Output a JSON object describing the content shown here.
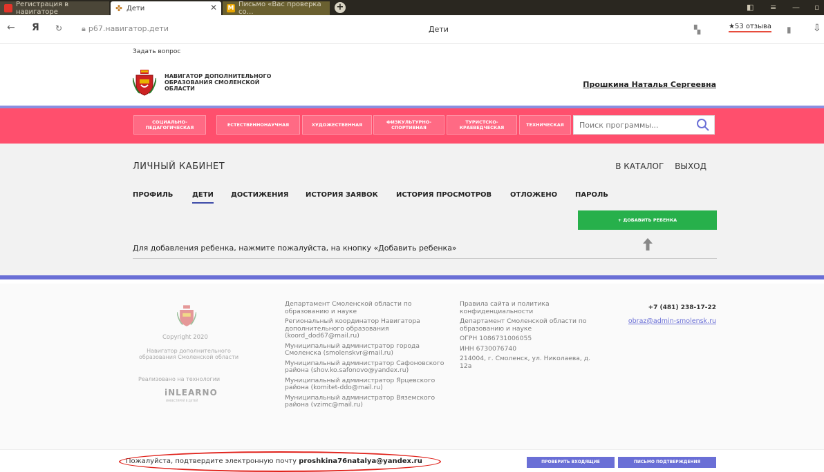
{
  "browser": {
    "tabs": [
      {
        "title": "Регистрация в навигаторе"
      },
      {
        "title": "Дети"
      },
      {
        "title": "Письмо «Вас проверка со…"
      }
    ],
    "url": "р67.навигатор.дети",
    "page_title": "Дети",
    "reviews": "★53 отзыва"
  },
  "header": {
    "ask": "Задать вопрос",
    "logo_text": "НАВИГАТОР ДОПОЛНИТЕЛЬНОГО ОБРАЗОВАНИЯ СМОЛЕНСКОЙ ОБЛАСТИ",
    "user_name": "Прошкина Наталья Сергеевна"
  },
  "categories": [
    "СОЦИАЛЬНО-ПЕДАГОГИЧЕСКАЯ",
    "ЕСТЕСТВЕННОНАУЧНАЯ",
    "ХУДОЖЕСТВЕННАЯ",
    "ФИЗКУЛЬТУРНО-СПОРТИВНАЯ",
    "ТУРИСТСКО-КРАЕВЕДЧЕСКАЯ",
    "ТЕХНИЧЕСКАЯ"
  ],
  "search": {
    "placeholder": "Поиск программы..."
  },
  "cabinet": {
    "title": "ЛИЧНЫЙ КАБИНЕТ",
    "catalog": "В КАТАЛОГ",
    "logout": "ВЫХОД",
    "tabs": [
      "ПРОФИЛЬ",
      "ДЕТИ",
      "ДОСТИЖЕНИЯ",
      "ИСТОРИЯ ЗАЯВОК",
      "ИСТОРИЯ ПРОСМОТРОВ",
      "ОТЛОЖЕНО",
      "ПАРОЛЬ"
    ],
    "active_tab": "ДЕТИ",
    "add_child": "+ ДОБАВИТЬ РЕБЕНКА",
    "hint": "Для добавления ребенка, нажмите пожалуйста, на кнопку «Добавить ребенка»"
  },
  "footer": {
    "copyright": "Copyright 2020",
    "navigator_name": "Навигатор дополнительного образования Смоленской области",
    "tech_label": "Реализовано на технологии",
    "tech_brand": "iNLEARNO",
    "tech_brand_sub": "ИНВЕСТИРУЙ В ДЕТЕЙ",
    "col2": [
      "Департамент Смоленской области по образованию и науке",
      "Региональный координатор Навигатора дополнительного образования (koord_dod67@mail.ru)",
      "Муниципальный администратор города Смоленска (smolenskvr@mail.ru)",
      "Муниципальный администратор Сафоновского района (shov.ko.safonovo@yandex.ru)",
      "Муниципальный администратор Ярцевского района (komitet-ddo@mail.ru)",
      "Муниципальный администратор Вяземского района (vzimc@mail.ru)"
    ],
    "col3": [
      "Правила сайта и политика конфиденциальности",
      "Департамент Смоленской области по образованию и науке",
      "ОГРН 1086731006055",
      "ИНН 6730076740",
      "214004, г. Смоленск, ул. Николаева, д. 12а"
    ],
    "phone": "+7 (481) 238-17-22",
    "email": "obraz@admin-smolensk.ru"
  },
  "confirm": {
    "text": "Пожалуйста, подтвердите электронную почту",
    "email": "proshkina76natalya@yandex.ru",
    "check_btn": "ПРОВЕРИТЬ ВХОДЯЩИЕ",
    "letter_btn": "ПИСЬМО ПОДТВЕРЖДЕНИЯ"
  },
  "colors": {
    "category_bar": "#ff4f6d",
    "accent_purple": "#6a6fd6",
    "add_button": "#27b04b",
    "annotation_red": "#e0231c"
  }
}
